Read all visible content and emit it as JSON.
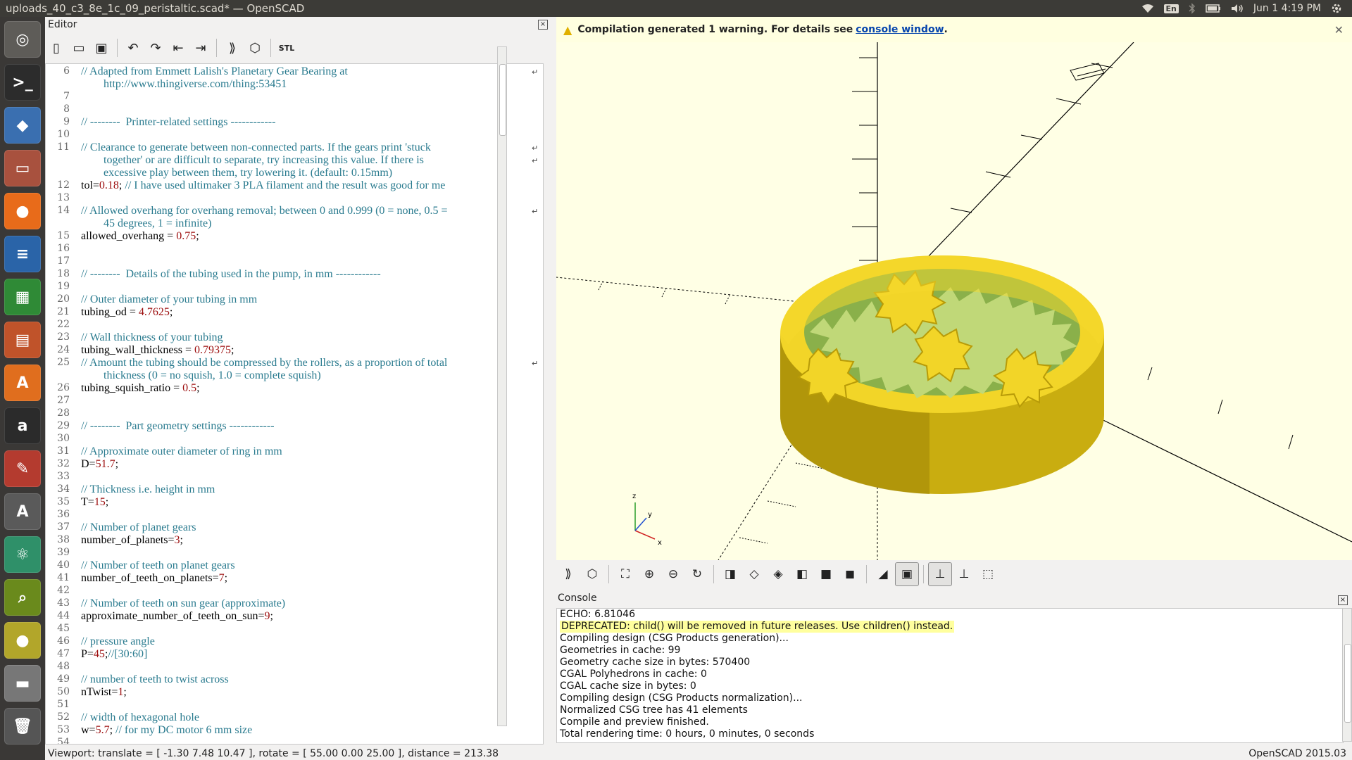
{
  "window": {
    "title": "uploads_40_c3_8e_1c_09_peristaltic.scad* — OpenSCAD",
    "indicators": {
      "lang": "En",
      "clock": "Jun 1  4:19 PM"
    }
  },
  "launcher": {
    "items": [
      {
        "name": "ubuntu-dash-icon",
        "glyph": "◎",
        "color": "#5e5c58"
      },
      {
        "name": "terminal-icon",
        "glyph": ">_",
        "color": "#2c2c2c"
      },
      {
        "name": "cube-app-icon",
        "glyph": "◆",
        "color": "#3a6fb0"
      },
      {
        "name": "files-icon",
        "glyph": "▭",
        "color": "#a8513e"
      },
      {
        "name": "firefox-icon",
        "glyph": "●",
        "color": "#e86b1a"
      },
      {
        "name": "writer-icon",
        "glyph": "≡",
        "color": "#2a64a8"
      },
      {
        "name": "calc-icon",
        "glyph": "▦",
        "color": "#2f8a36"
      },
      {
        "name": "impress-icon",
        "glyph": "▤",
        "color": "#c0532a"
      },
      {
        "name": "software-center-icon",
        "glyph": "A",
        "color": "#e06e1e"
      },
      {
        "name": "amazon-icon",
        "glyph": "a",
        "color": "#2b2b2b"
      },
      {
        "name": "settings-icon",
        "glyph": "✎",
        "color": "#b43b2f"
      },
      {
        "name": "updater-icon",
        "glyph": "A",
        "color": "#5a5a5a"
      },
      {
        "name": "atom-icon",
        "glyph": "⚛",
        "color": "#2f9069"
      },
      {
        "name": "image-viewer-icon",
        "glyph": "⌕",
        "color": "#6a8a1c"
      },
      {
        "name": "openscad-icon",
        "glyph": "●",
        "color": "#b2a62a"
      },
      {
        "name": "disk-icon",
        "glyph": "▬",
        "color": "#777"
      },
      {
        "name": "trash-icon",
        "glyph": "🗑",
        "color": "#555"
      }
    ]
  },
  "editor": {
    "header": "Editor",
    "toolbar": [
      {
        "name": "new-file-icon",
        "glyph": "▯"
      },
      {
        "name": "open-file-icon",
        "glyph": "▭"
      },
      {
        "name": "save-icon",
        "glyph": "▣"
      },
      {
        "name": "undo-icon",
        "glyph": "↶"
      },
      {
        "name": "redo-icon",
        "glyph": "↷"
      },
      {
        "name": "unindent-icon",
        "glyph": "⇤"
      },
      {
        "name": "indent-icon",
        "glyph": "⇥"
      },
      {
        "name": "preview-icon",
        "glyph": "⟫"
      },
      {
        "name": "render-icon",
        "glyph": "⬡"
      },
      {
        "name": "export-stl-icon",
        "glyph": "STL"
      }
    ],
    "lines": [
      {
        "n": "6",
        "parts": [
          {
            "t": "// Adapted from Emmett Lalish's Planetary Gear Bearing at",
            "c": "cm"
          }
        ],
        "wrap": true
      },
      {
        "n": "",
        "parts": [
          {
            "t": "        http://www.thingiverse.com/thing:53451",
            "c": "cm"
          }
        ]
      },
      {
        "n": "7",
        "parts": []
      },
      {
        "n": "8",
        "parts": []
      },
      {
        "n": "9",
        "parts": [
          {
            "t": "// --------  Printer-related settings ------------",
            "c": "cm"
          }
        ]
      },
      {
        "n": "10",
        "parts": []
      },
      {
        "n": "11",
        "parts": [
          {
            "t": "// Clearance to generate between non-connected parts. If the gears print 'stuck",
            "c": "cm"
          }
        ],
        "wrap": true
      },
      {
        "n": "",
        "parts": [
          {
            "t": "        together' or are difficult to separate, try increasing this value. If there is",
            "c": "cm"
          }
        ],
        "wrap": true
      },
      {
        "n": "",
        "parts": [
          {
            "t": "        excessive play between them, try lowering it. (default: 0.15mm)",
            "c": "cm"
          }
        ]
      },
      {
        "n": "12",
        "parts": [
          {
            "t": "tol="
          },
          {
            "t": "0.18",
            "c": "nm"
          },
          {
            "t": "; "
          },
          {
            "t": "// I have used ultimaker 3 PLA filament and the result was good for me",
            "c": "cm"
          }
        ]
      },
      {
        "n": "13",
        "parts": []
      },
      {
        "n": "14",
        "parts": [
          {
            "t": "// Allowed overhang for overhang removal; between 0 and 0.999 (0 = none, 0.5 =",
            "c": "cm"
          }
        ],
        "wrap": true
      },
      {
        "n": "",
        "parts": [
          {
            "t": "        45 degrees, 1 = infinite)",
            "c": "cm"
          }
        ]
      },
      {
        "n": "15",
        "parts": [
          {
            "t": "allowed_overhang = "
          },
          {
            "t": "0.75",
            "c": "nm"
          },
          {
            "t": ";"
          }
        ]
      },
      {
        "n": "16",
        "parts": []
      },
      {
        "n": "17",
        "parts": []
      },
      {
        "n": "18",
        "parts": [
          {
            "t": "// --------  Details of the tubing used in the pump, in mm ------------",
            "c": "cm"
          }
        ]
      },
      {
        "n": "19",
        "parts": []
      },
      {
        "n": "20",
        "parts": [
          {
            "t": "// Outer diameter of your tubing in mm",
            "c": "cm"
          }
        ]
      },
      {
        "n": "21",
        "parts": [
          {
            "t": "tubing_od = "
          },
          {
            "t": "4.7625",
            "c": "nm"
          },
          {
            "t": ";"
          }
        ]
      },
      {
        "n": "22",
        "parts": []
      },
      {
        "n": "23",
        "parts": [
          {
            "t": "// Wall thickness of your tubing",
            "c": "cm"
          }
        ]
      },
      {
        "n": "24",
        "parts": [
          {
            "t": "tubing_wall_thickness = "
          },
          {
            "t": "0.79375",
            "c": "nm"
          },
          {
            "t": ";"
          }
        ]
      },
      {
        "n": "25",
        "parts": [
          {
            "t": "// Amount the tubing should be compressed by the rollers, as a proportion of total",
            "c": "cm"
          }
        ],
        "wrap": true
      },
      {
        "n": "",
        "parts": [
          {
            "t": "        thickness (0 = no squish, 1.0 = complete squish)",
            "c": "cm"
          }
        ]
      },
      {
        "n": "26",
        "parts": [
          {
            "t": "tubing_squish_ratio = "
          },
          {
            "t": "0.5",
            "c": "nm"
          },
          {
            "t": ";"
          }
        ]
      },
      {
        "n": "27",
        "parts": []
      },
      {
        "n": "28",
        "parts": []
      },
      {
        "n": "29",
        "parts": [
          {
            "t": "// --------  Part geometry settings ------------",
            "c": "cm"
          }
        ]
      },
      {
        "n": "30",
        "parts": []
      },
      {
        "n": "31",
        "parts": [
          {
            "t": "// Approximate outer diameter of ring in mm",
            "c": "cm"
          }
        ]
      },
      {
        "n": "32",
        "parts": [
          {
            "t": "D="
          },
          {
            "t": "51.7",
            "c": "nm"
          },
          {
            "t": ";"
          }
        ]
      },
      {
        "n": "33",
        "parts": []
      },
      {
        "n": "34",
        "parts": [
          {
            "t": "// Thickness i.e. height in mm",
            "c": "cm"
          }
        ]
      },
      {
        "n": "35",
        "parts": [
          {
            "t": "T="
          },
          {
            "t": "15",
            "c": "nm"
          },
          {
            "t": ";"
          }
        ]
      },
      {
        "n": "36",
        "parts": []
      },
      {
        "n": "37",
        "parts": [
          {
            "t": "// Number of planet gears",
            "c": "cm"
          }
        ]
      },
      {
        "n": "38",
        "parts": [
          {
            "t": "number_of_planets="
          },
          {
            "t": "3",
            "c": "nm"
          },
          {
            "t": ";"
          }
        ]
      },
      {
        "n": "39",
        "parts": []
      },
      {
        "n": "40",
        "parts": [
          {
            "t": "// Number of teeth on planet gears",
            "c": "cm"
          }
        ]
      },
      {
        "n": "41",
        "parts": [
          {
            "t": "number_of_teeth_on_planets="
          },
          {
            "t": "7",
            "c": "nm"
          },
          {
            "t": ";"
          }
        ]
      },
      {
        "n": "42",
        "parts": []
      },
      {
        "n": "43",
        "parts": [
          {
            "t": "// Number of teeth on sun gear (approximate)",
            "c": "cm"
          }
        ]
      },
      {
        "n": "44",
        "parts": [
          {
            "t": "approximate_number_of_teeth_on_sun="
          },
          {
            "t": "9",
            "c": "nm"
          },
          {
            "t": ";"
          }
        ]
      },
      {
        "n": "45",
        "parts": []
      },
      {
        "n": "46",
        "parts": [
          {
            "t": "// pressure angle",
            "c": "cm"
          }
        ]
      },
      {
        "n": "47",
        "parts": [
          {
            "t": "P="
          },
          {
            "t": "45",
            "c": "nm"
          },
          {
            "t": ";"
          },
          {
            "t": "//[30:60]",
            "c": "cm"
          }
        ]
      },
      {
        "n": "48",
        "parts": []
      },
      {
        "n": "49",
        "parts": [
          {
            "t": "// number of teeth to twist across",
            "c": "cm"
          }
        ]
      },
      {
        "n": "50",
        "parts": [
          {
            "t": "nTwist="
          },
          {
            "t": "1",
            "c": "nm"
          },
          {
            "t": ";"
          }
        ]
      },
      {
        "n": "51",
        "parts": []
      },
      {
        "n": "52",
        "parts": [
          {
            "t": "// width of hexagonal hole",
            "c": "cm"
          }
        ]
      },
      {
        "n": "53",
        "parts": [
          {
            "t": "w="
          },
          {
            "t": "5.7",
            "c": "nm"
          },
          {
            "t": "; "
          },
          {
            "t": "// for my DC motor 6 mm size",
            "c": "cm"
          }
        ]
      },
      {
        "n": "54",
        "parts": []
      }
    ]
  },
  "viewer": {
    "warning": {
      "text": "Compilation generated 1 warning. For details see",
      "link": "console window",
      "tail": "."
    },
    "axis_labels": {
      "z": "z",
      "y": "y",
      "x": "x"
    },
    "toolbar": [
      {
        "name": "preview-icon",
        "glyph": "⟫"
      },
      {
        "name": "render-icon",
        "glyph": "⬡"
      },
      {
        "name": "view-all-icon",
        "glyph": "⛶"
      },
      {
        "name": "zoom-in-icon",
        "glyph": "⊕"
      },
      {
        "name": "zoom-out-icon",
        "glyph": "⊖"
      },
      {
        "name": "reset-view-icon",
        "glyph": "↻"
      },
      {
        "name": "view-right-icon",
        "glyph": "◨"
      },
      {
        "name": "view-top-icon",
        "glyph": "◇"
      },
      {
        "name": "view-bottom-icon",
        "glyph": "◈"
      },
      {
        "name": "view-left-icon",
        "glyph": "◧"
      },
      {
        "name": "view-front-icon",
        "glyph": "■"
      },
      {
        "name": "view-back-icon",
        "glyph": "◼"
      },
      {
        "name": "perspective-icon",
        "glyph": "◢"
      },
      {
        "name": "orthogonal-icon",
        "glyph": "▣"
      },
      {
        "name": "show-axes-icon",
        "glyph": "⊥"
      },
      {
        "name": "show-scale-icon",
        "glyph": "⊥"
      },
      {
        "name": "show-edges-icon",
        "glyph": "⬚"
      }
    ]
  },
  "console": {
    "header": "Console",
    "lines": [
      {
        "text": "ECHO: 6.81046"
      },
      {
        "text": "DEPRECATED: child() will be removed in future releases. Use children() instead.",
        "highlight": true
      },
      {
        "text": "Compiling design (CSG Products generation)..."
      },
      {
        "text": "Geometries in cache: 99"
      },
      {
        "text": "Geometry cache size in bytes: 570400"
      },
      {
        "text": "CGAL Polyhedrons in cache: 0"
      },
      {
        "text": "CGAL cache size in bytes: 0"
      },
      {
        "text": "Compiling design (CSG Products normalization)..."
      },
      {
        "text": "Normalized CSG tree has 41 elements"
      },
      {
        "text": "Compile and preview finished."
      },
      {
        "text": "Total rendering time: 0 hours, 0 minutes, 0 seconds"
      }
    ]
  },
  "status": {
    "viewport": "Viewport: translate = [ -1.30 7.48 10.47 ], rotate = [ 55.00 0.00 25.00 ], distance = 213.38",
    "version": "OpenSCAD 2015.03"
  },
  "colors": {
    "model": "#f0d020",
    "model_dark": "#7a6a00",
    "viewport_bg": "#ffffe5",
    "gear_green": "#9ec060"
  }
}
